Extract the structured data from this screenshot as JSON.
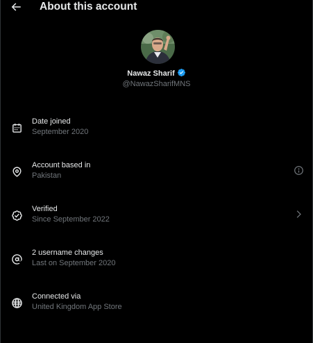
{
  "header": {
    "title": "About this account",
    "back_icon": "arrow-left-icon"
  },
  "profile": {
    "name": "Nawaz Sharif",
    "handle": "@NawazSharifMNS",
    "verified": true,
    "badge_color": "#1d9bf0"
  },
  "rows": [
    {
      "icon": "calendar-icon",
      "label": "Date joined",
      "sub": "September 2020",
      "trail": ""
    },
    {
      "icon": "location-pin-icon",
      "label": "Account based in",
      "sub": "Pakistan",
      "trail": "info-icon"
    },
    {
      "icon": "verified-check-icon",
      "label": "Verified",
      "sub": "Since September 2022",
      "trail": "chevron-right-icon"
    },
    {
      "icon": "at-sign-icon",
      "label": "2 username changes",
      "sub": "Last on September 2020",
      "trail": ""
    },
    {
      "icon": "globe-icon",
      "label": "Connected via",
      "sub": "United Kingdom App Store",
      "trail": ""
    }
  ],
  "colors": {
    "background": "#000000",
    "text_primary": "#e7e9ea",
    "text_secondary": "#71767b"
  }
}
